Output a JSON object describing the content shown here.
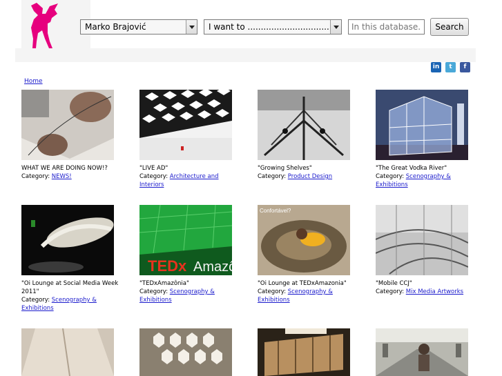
{
  "header": {
    "author_select": {
      "value": "Marko Brajović"
    },
    "intent_select": {
      "value": "I want to ................................"
    },
    "search": {
      "placeholder": "In this database...",
      "button_label": "Search"
    }
  },
  "social": [
    {
      "name": "linkedin",
      "glyph": "in",
      "color": "#1a64b4"
    },
    {
      "name": "twitter",
      "glyph": "t",
      "color": "#4aa8d8"
    },
    {
      "name": "facebook",
      "glyph": "f",
      "color": "#3a589e"
    }
  ],
  "breadcrumb": {
    "home": "Home"
  },
  "category_prefix": "Category:",
  "items": [
    {
      "title": "WHAT WE ARE DOING NOW!?",
      "category": "NEWS!"
    },
    {
      "title": "\"LIVE AD\"",
      "category": "Architecture and Interiors"
    },
    {
      "title": "\"Growing Shelves\"",
      "category": "Product Design"
    },
    {
      "title": "\"The Great Vodka River\"",
      "category": "Scenography & Exhibitions"
    },
    {
      "title": "\"Oi Lounge at Social Media Week 2011\"",
      "category": "Scenography & Exhibitions"
    },
    {
      "title": "\"TEDxAmazônia\"",
      "category": "Scenography & Exhibitions"
    },
    {
      "title": "\"Oi Lounge at TEDxAmazonia\"",
      "category": "Scenography & Exhibitions"
    },
    {
      "title": "\"Mobile CCJ\"",
      "category": "Mix Media Artworks"
    }
  ],
  "thumb_text": {
    "tedx_tag": "TEDx",
    "tedx_place": "Amazôn",
    "confortavel": "Confortável?"
  },
  "colors": {
    "logo_pink": "#e6007e",
    "link": "#1a1acc"
  }
}
